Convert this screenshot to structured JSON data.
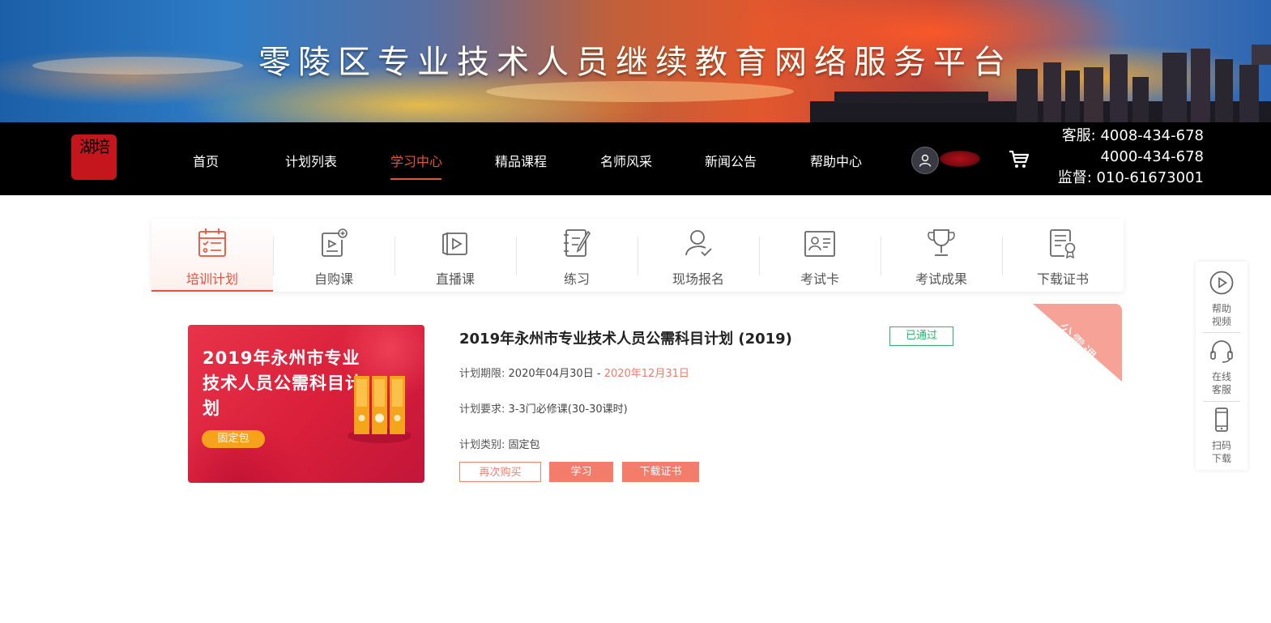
{
  "banner": {
    "title": "零陵区专业技术人员继续教育网络服务平台"
  },
  "logo": {
    "text": "湖培"
  },
  "nav": {
    "items": [
      {
        "label": "首页"
      },
      {
        "label": "计划列表"
      },
      {
        "label": "学习中心",
        "active": true
      },
      {
        "label": "精品课程"
      },
      {
        "label": "名师风采"
      },
      {
        "label": "新闻公告"
      },
      {
        "label": "帮助中心"
      }
    ],
    "hotline": {
      "line1": "客服: 4008-434-678",
      "line2": "4000-434-678",
      "line3": "监督: 010-61673001"
    }
  },
  "tabs": [
    {
      "label": "培训计划",
      "icon": "calendar-checklist-icon",
      "active": true
    },
    {
      "label": "自购课",
      "icon": "purchased-course-icon"
    },
    {
      "label": "直播课",
      "icon": "live-video-icon"
    },
    {
      "label": "练习",
      "icon": "notebook-pen-icon"
    },
    {
      "label": "现场报名",
      "icon": "user-check-icon"
    },
    {
      "label": "考试卡",
      "icon": "id-card-icon"
    },
    {
      "label": "考试成果",
      "icon": "trophy-icon"
    },
    {
      "label": "下载证书",
      "icon": "certificate-icon"
    }
  ],
  "plan": {
    "thumb_title": "2019年永州市专业技术人员公需科目计划",
    "thumb_badge": "固定包",
    "title": "2019年永州市专业技术人员公需科目计划 (2019)",
    "status": "已通过",
    "period_label": "计划期限:",
    "period_start": "2020年04月30日",
    "period_sep": "-",
    "period_end": "2020年12月31日",
    "requirement_label": "计划要求:",
    "requirement_value": "3-3门必修课(30-30课时)",
    "category_label": "计划类别:",
    "category_value": "固定包",
    "buttons": {
      "rebuy": "再次购买",
      "study": "学习",
      "download": "下载证书"
    },
    "ribbon": "公需课"
  },
  "side": {
    "help_video": "帮助视频",
    "online_service": "在线客服",
    "scan_download": "扫码下载"
  },
  "colors": {
    "accent": "#e8513c",
    "pass": "#2fb36b",
    "button": "#f47c6b",
    "nav_bg": "#000000"
  }
}
